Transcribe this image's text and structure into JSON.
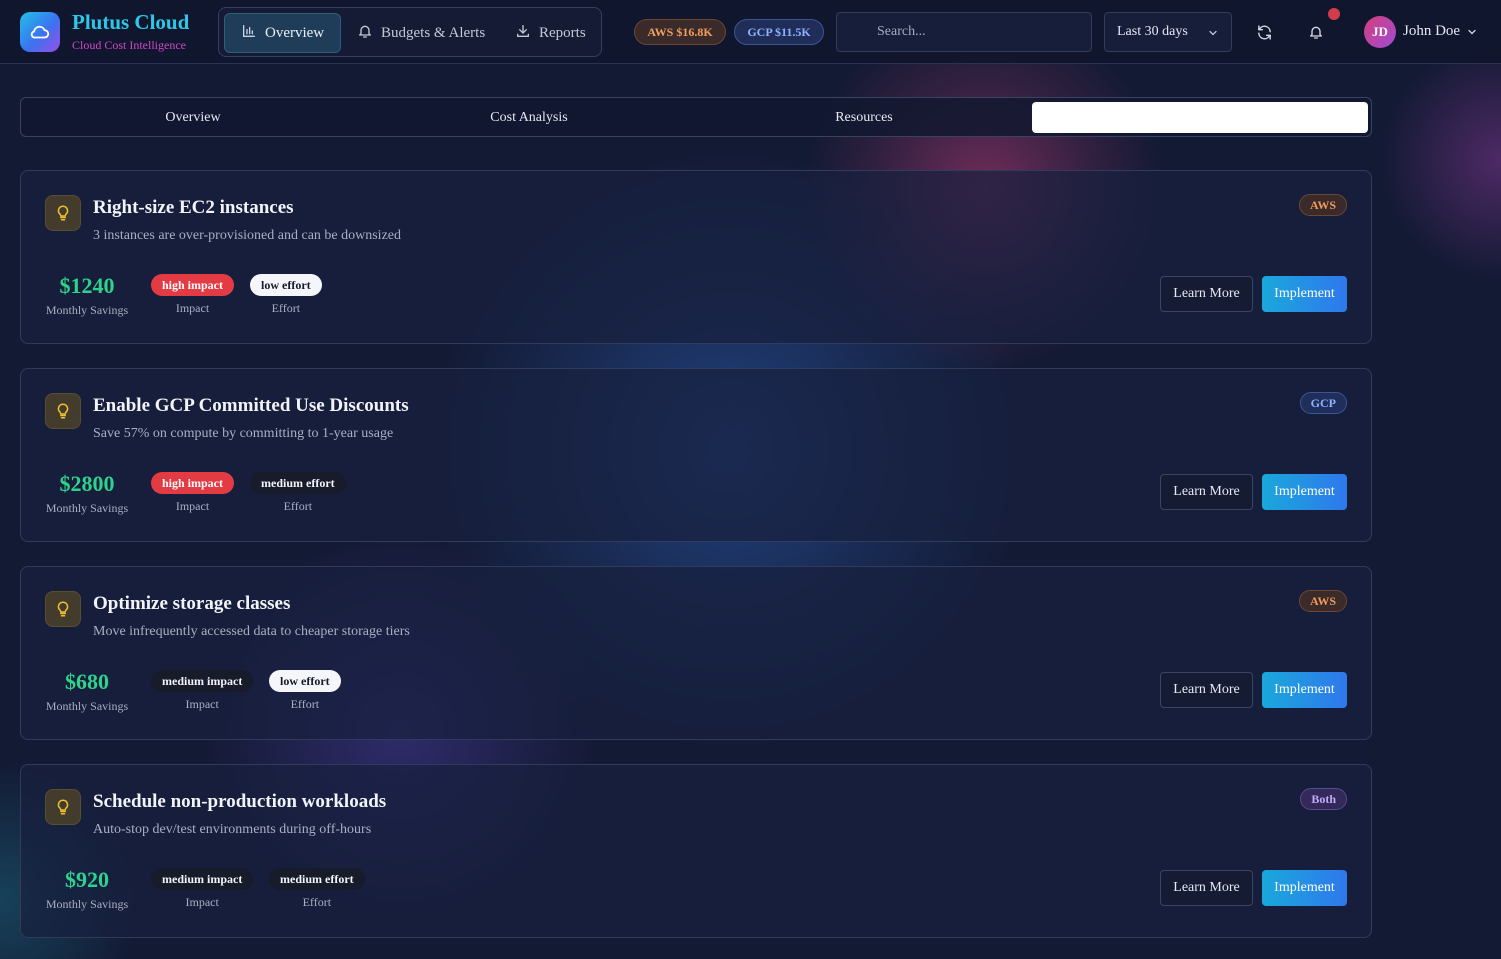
{
  "brand": {
    "name": "Plutus Cloud",
    "tagline": "Cloud Cost Intelligence"
  },
  "nav": [
    {
      "label": "Overview",
      "icon": "bar-chart-icon",
      "active": true
    },
    {
      "label": "Budgets & Alerts",
      "icon": "bell-icon",
      "active": false
    },
    {
      "label": "Reports",
      "icon": "download-icon",
      "active": false
    }
  ],
  "cloud_costs": {
    "aws": "AWS $16.8K",
    "gcp": "GCP $11.5K"
  },
  "search": {
    "placeholder": "Search..."
  },
  "date_range": {
    "selected": "Last 30 days"
  },
  "user": {
    "initials": "JD",
    "name": "John Doe"
  },
  "tabs": [
    {
      "label": "Overview",
      "active": false
    },
    {
      "label": "Cost Analysis",
      "active": false
    },
    {
      "label": "Resources",
      "active": false
    },
    {
      "label": "",
      "active": true
    }
  ],
  "labels": {
    "monthly_savings": "Monthly Savings",
    "impact": "Impact",
    "effort": "Effort",
    "learn_more": "Learn More",
    "implement": "Implement"
  },
  "colors": {
    "accent": "#2cc8e8",
    "savings": "#2fd28c",
    "high": "#e23b44",
    "aws": "#f09a5a",
    "gcp": "#8fb2ff"
  },
  "recommendations": [
    {
      "title": "Right-size EC2 instances",
      "description": "3 instances are over-provisioned and can be downsized",
      "provider": "AWS",
      "savings": "$1240",
      "impact": "high impact",
      "effort": "low effort"
    },
    {
      "title": "Enable GCP Committed Use Discounts",
      "description": "Save 57% on compute by committing to 1-year usage",
      "provider": "GCP",
      "savings": "$2800",
      "impact": "high impact",
      "effort": "medium effort"
    },
    {
      "title": "Optimize storage classes",
      "description": "Move infrequently accessed data to cheaper storage tiers",
      "provider": "AWS",
      "savings": "$680",
      "impact": "medium impact",
      "effort": "low effort"
    },
    {
      "title": "Schedule non-production workloads",
      "description": "Auto-stop dev/test environments during off-hours",
      "provider": "Both",
      "savings": "$920",
      "impact": "medium impact",
      "effort": "medium effort"
    }
  ]
}
